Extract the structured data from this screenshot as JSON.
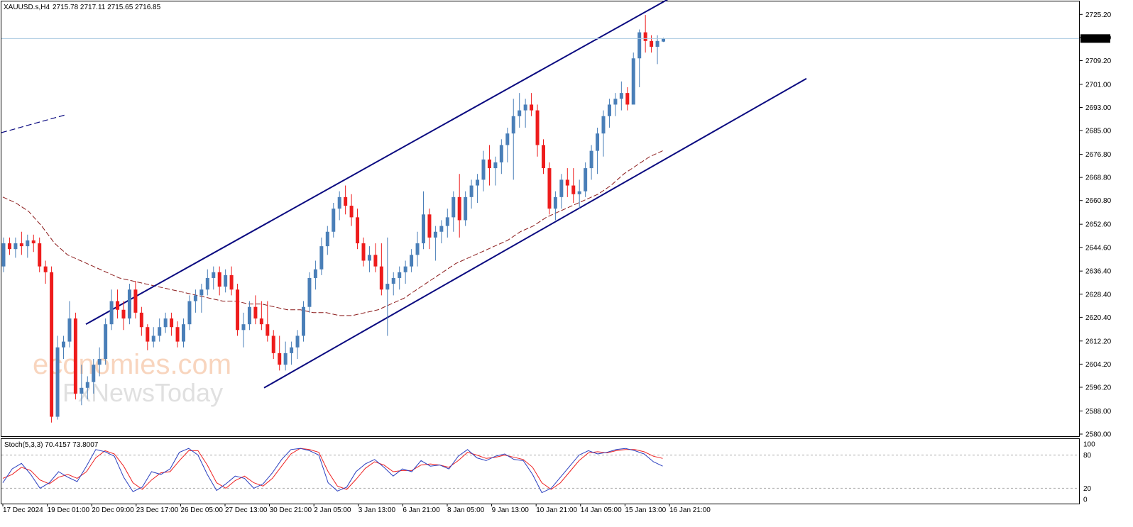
{
  "header": {
    "symbol": "XAUUSD.s,H4",
    "ohlc": "2715.78 2717.11 2715.65 2716.85"
  },
  "indicator": {
    "label": "Stoch(5,3,3) 70.4157 73.8007",
    "levels": [
      "100",
      "80",
      "20",
      "0"
    ]
  },
  "watermark": {
    "line1": "economies.com",
    "line2": "FxNewsToday"
  },
  "colors": {
    "up": "#4a7fb8",
    "down": "#ee1c1c",
    "channel": "#0a0a80",
    "ma": "#8b1a1a",
    "stoch_main": "#2a3fbf",
    "stoch_signal": "#ee2222",
    "price_line": "#a8c8e0"
  },
  "chart_data": {
    "type": "candlestick",
    "timeframe": "H4",
    "ylim": [
      2580.0,
      2729.2
    ],
    "y_ticks": [
      "2725.20",
      "2717.20",
      "2709.20",
      "2701.00",
      "2693.00",
      "2685.00",
      "2676.80",
      "2668.80",
      "2660.80",
      "2652.60",
      "2644.60",
      "2636.40",
      "2628.40",
      "2620.40",
      "2612.20",
      "2604.20",
      "2596.20",
      "2588.00",
      "2580.00"
    ],
    "current_price": "2716.85",
    "x_labels": [
      "17 Dec 2024",
      "19 Dec 01:00",
      "20 Dec 09:00",
      "23 Dec 17:00",
      "26 Dec 05:00",
      "27 Dec 13:00",
      "30 Dec 21:00",
      "2 Jan 05:00",
      "3 Jan 13:00",
      "6 Jan 21:00",
      "8 Jan 05:00",
      "9 Jan 13:00",
      "10 Jan 21:00",
      "14 Jan 05:00",
      "15 Jan 13:00",
      "16 Jan 21:00"
    ],
    "candles": [
      [
        2638,
        2648,
        2636,
        2646
      ],
      [
        2646,
        2648,
        2642,
        2644
      ],
      [
        2644,
        2648,
        2641,
        2646
      ],
      [
        2646,
        2650,
        2642,
        2645
      ],
      [
        2645,
        2649,
        2641,
        2647
      ],
      [
        2647,
        2649,
        2643,
        2646
      ],
      [
        2646,
        2648,
        2636,
        2638
      ],
      [
        2638,
        2640,
        2632,
        2636
      ],
      [
        2636,
        2638,
        2584,
        2586
      ],
      [
        2586,
        2614,
        2585,
        2610
      ],
      [
        2610,
        2614,
        2606,
        2612
      ],
      [
        2612,
        2626,
        2610,
        2620
      ],
      [
        2620,
        2622,
        2592,
        2594
      ],
      [
        2594,
        2604,
        2590,
        2596
      ],
      [
        2596,
        2600,
        2592,
        2598
      ],
      [
        2598,
        2606,
        2594,
        2604
      ],
      [
        2604,
        2610,
        2600,
        2606
      ],
      [
        2606,
        2620,
        2604,
        2618
      ],
      [
        2618,
        2630,
        2616,
        2626
      ],
      [
        2626,
        2630,
        2620,
        2623
      ],
      [
        2623,
        2626,
        2616,
        2620
      ],
      [
        2620,
        2632,
        2618,
        2630
      ],
      [
        2630,
        2633,
        2620,
        2622
      ],
      [
        2622,
        2624,
        2614,
        2617
      ],
      [
        2617,
        2618,
        2609,
        2612
      ],
      [
        2612,
        2617,
        2610,
        2614
      ],
      [
        2614,
        2620,
        2612,
        2617
      ],
      [
        2617,
        2622,
        2615,
        2620
      ],
      [
        2620,
        2622,
        2614,
        2617
      ],
      [
        2617,
        2619,
        2610,
        2612
      ],
      [
        2612,
        2620,
        2610,
        2618
      ],
      [
        2618,
        2628,
        2616,
        2626
      ],
      [
        2626,
        2630,
        2622,
        2628
      ],
      [
        2628,
        2632,
        2622,
        2630
      ],
      [
        2630,
        2637,
        2628,
        2634
      ],
      [
        2634,
        2638,
        2630,
        2636
      ],
      [
        2636,
        2638,
        2628,
        2631
      ],
      [
        2631,
        2637,
        2629,
        2635
      ],
      [
        2635,
        2638,
        2628,
        2630
      ],
      [
        2630,
        2632,
        2614,
        2616
      ],
      [
        2616,
        2622,
        2610,
        2618
      ],
      [
        2618,
        2626,
        2616,
        2624
      ],
      [
        2624,
        2628,
        2618,
        2620
      ],
      [
        2620,
        2626,
        2616,
        2618
      ],
      [
        2618,
        2626,
        2612,
        2614
      ],
      [
        2614,
        2616,
        2606,
        2608
      ],
      [
        2608,
        2614,
        2602,
        2604
      ],
      [
        2604,
        2612,
        2602,
        2608
      ],
      [
        2608,
        2612,
        2604,
        2610
      ],
      [
        2610,
        2616,
        2606,
        2614
      ],
      [
        2614,
        2626,
        2612,
        2624
      ],
      [
        2624,
        2636,
        2622,
        2634
      ],
      [
        2634,
        2640,
        2630,
        2637
      ],
      [
        2637,
        2648,
        2635,
        2645
      ],
      [
        2645,
        2652,
        2642,
        2650
      ],
      [
        2650,
        2660,
        2648,
        2658
      ],
      [
        2658,
        2664,
        2654,
        2662
      ],
      [
        2662,
        2666,
        2656,
        2659
      ],
      [
        2659,
        2663,
        2652,
        2655
      ],
      [
        2655,
        2658,
        2644,
        2646
      ],
      [
        2646,
        2648,
        2638,
        2640
      ],
      [
        2640,
        2645,
        2636,
        2642
      ],
      [
        2642,
        2646,
        2636,
        2638
      ],
      [
        2638,
        2646,
        2628,
        2630
      ],
      [
        2630,
        2648,
        2614,
        2632
      ],
      [
        2632,
        2636,
        2628,
        2634
      ],
      [
        2634,
        2638,
        2630,
        2636
      ],
      [
        2636,
        2640,
        2632,
        2638
      ],
      [
        2638,
        2644,
        2636,
        2642
      ],
      [
        2642,
        2650,
        2638,
        2646
      ],
      [
        2646,
        2664,
        2644,
        2656
      ],
      [
        2656,
        2658,
        2644,
        2648
      ],
      [
        2648,
        2652,
        2640,
        2650
      ],
      [
        2650,
        2654,
        2646,
        2652
      ],
      [
        2652,
        2658,
        2648,
        2655
      ],
      [
        2655,
        2664,
        2650,
        2662
      ],
      [
        2662,
        2670,
        2648,
        2654
      ],
      [
        2654,
        2664,
        2652,
        2662
      ],
      [
        2662,
        2668,
        2658,
        2666
      ],
      [
        2666,
        2670,
        2660,
        2668
      ],
      [
        2668,
        2678,
        2664,
        2675
      ],
      [
        2675,
        2680,
        2666,
        2672
      ],
      [
        2672,
        2676,
        2666,
        2674
      ],
      [
        2674,
        2682,
        2670,
        2680
      ],
      [
        2680,
        2686,
        2674,
        2684
      ],
      [
        2684,
        2696,
        2668,
        2690
      ],
      [
        2690,
        2698,
        2686,
        2692
      ],
      [
        2692,
        2696,
        2686,
        2694
      ],
      [
        2694,
        2698,
        2690,
        2692
      ],
      [
        2692,
        2694,
        2676,
        2680
      ],
      [
        2680,
        2682,
        2670,
        2672
      ],
      [
        2672,
        2674,
        2656,
        2658
      ],
      [
        2658,
        2664,
        2654,
        2662
      ],
      [
        2662,
        2670,
        2658,
        2668
      ],
      [
        2668,
        2672,
        2662,
        2666
      ],
      [
        2666,
        2672,
        2660,
        2663
      ],
      [
        2663,
        2668,
        2658,
        2664
      ],
      [
        2664,
        2674,
        2662,
        2672
      ],
      [
        2672,
        2680,
        2668,
        2678
      ],
      [
        2678,
        2686,
        2670,
        2684
      ],
      [
        2684,
        2692,
        2676,
        2690
      ],
      [
        2690,
        2696,
        2686,
        2694
      ],
      [
        2694,
        2698,
        2690,
        2696
      ],
      [
        2696,
        2702,
        2692,
        2698
      ],
      [
        2698,
        2700,
        2692,
        2694
      ],
      [
        2694,
        2712,
        2700,
        2710
      ],
      [
        2710,
        2720,
        2700,
        2719
      ],
      [
        2719,
        2725,
        2712,
        2716
      ],
      [
        2716,
        2718,
        2712,
        2714
      ],
      [
        2714,
        2718,
        2708,
        2716
      ],
      [
        2715.78,
        2717.11,
        2715.65,
        2716.85
      ]
    ],
    "ma": [
      2662,
      2660,
      2657,
      2652,
      2646,
      2642,
      2640,
      2638,
      2636,
      2634,
      2633,
      2632,
      2631,
      2630,
      2629,
      2628,
      2627,
      2626,
      2626,
      2625,
      2625,
      2624,
      2623,
      2623,
      2622,
      2622,
      2621,
      2621,
      2622,
      2623,
      2625,
      2627,
      2630,
      2633,
      2636,
      2639,
      2641,
      2643,
      2645,
      2647,
      2650,
      2652,
      2655,
      2657,
      2659,
      2661,
      2663,
      2666,
      2670,
      2673,
      2676,
      2678
    ],
    "channel_upper": [
      [
        2618,
        2632
      ],
      [
        2734,
        2744
      ]
    ],
    "channel_lower": [
      [
        2596,
        2612
      ],
      [
        2703,
        2714
      ]
    ],
    "stoch_main": [
      30,
      55,
      65,
      45,
      20,
      30,
      50,
      40,
      32,
      60,
      90,
      86,
      78,
      40,
      14,
      22,
      50,
      45,
      55,
      85,
      92,
      80,
      45,
      16,
      28,
      42,
      38,
      20,
      28,
      48,
      72,
      90,
      92,
      88,
      80,
      30,
      15,
      22,
      50,
      64,
      72,
      58,
      42,
      55,
      50,
      70,
      60,
      62,
      55,
      78,
      90,
      75,
      70,
      78,
      82,
      72,
      70,
      45,
      12,
      20,
      40,
      60,
      80,
      88,
      82,
      85,
      90,
      92,
      88,
      82,
      68,
      60
    ],
    "stoch_signal": [
      38,
      45,
      58,
      52,
      35,
      28,
      40,
      45,
      38,
      50,
      75,
      88,
      82,
      60,
      30,
      18,
      35,
      48,
      50,
      70,
      88,
      88,
      62,
      30,
      20,
      34,
      42,
      30,
      24,
      38,
      60,
      82,
      92,
      90,
      85,
      50,
      24,
      18,
      36,
      56,
      68,
      62,
      50,
      52,
      52,
      62,
      64,
      62,
      58,
      70,
      85,
      80,
      74,
      76,
      80,
      76,
      72,
      58,
      30,
      18,
      30,
      50,
      70,
      84,
      86,
      84,
      88,
      90,
      90,
      86,
      78,
      74
    ]
  }
}
